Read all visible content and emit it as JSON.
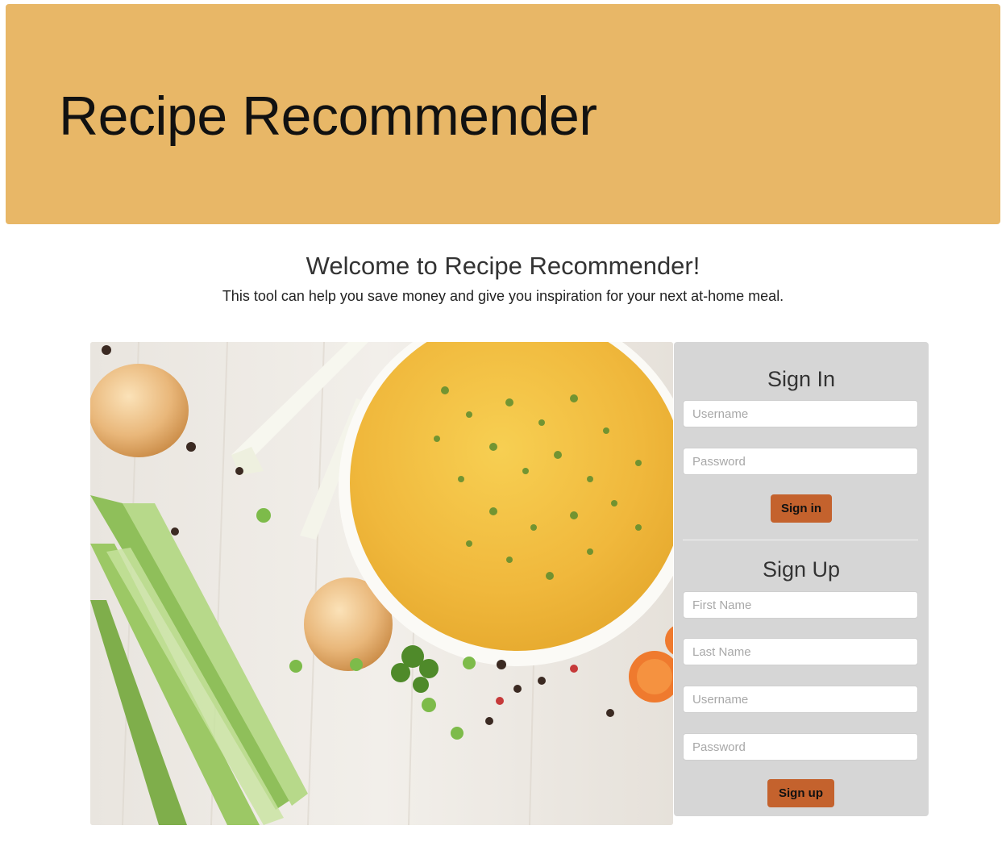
{
  "header": {
    "title": "Recipe Recommender",
    "background_color": "#e8b767"
  },
  "welcome": {
    "heading": "Welcome to Recipe Recommender!",
    "subtitle": "This tool can help you save money and give you inspiration for your next at-home meal."
  },
  "hero_image": {
    "subject": "bowl of broth soup with parsley, onions, leeks, peas and peppercorns on white wood"
  },
  "sign_in": {
    "heading": "Sign In",
    "username_placeholder": "Username",
    "password_placeholder": "Password",
    "button_label": "Sign in"
  },
  "sign_up": {
    "heading": "Sign Up",
    "first_name_placeholder": "First Name",
    "last_name_placeholder": "Last Name",
    "username_placeholder": "Username",
    "password_placeholder": "Password",
    "button_label": "Sign up"
  },
  "colors": {
    "accent": "#c4622d",
    "panel": "#d6d6d6"
  }
}
